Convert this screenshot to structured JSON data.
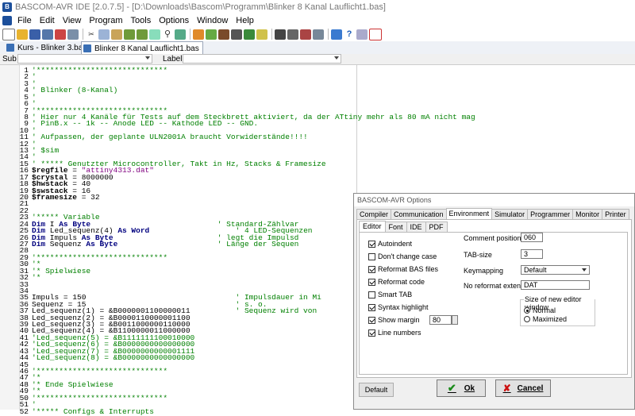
{
  "window": {
    "title": "BASCOM-AVR IDE [2.0.7.5] - [D:\\Downloads\\Bascom\\Programm\\Blinker 8 Kanal Lauflicht1.bas]"
  },
  "menu": [
    "File",
    "Edit",
    "View",
    "Program",
    "Tools",
    "Options",
    "Window",
    "Help"
  ],
  "tabs": [
    {
      "label": "Kurs - Blinker 3.bas",
      "active": false
    },
    {
      "label": "Blinker 8 Kanal Lauflicht1.bas",
      "active": true
    }
  ],
  "subbar": {
    "sub_label": "Sub",
    "label_label": "Label"
  },
  "code": [
    [
      [
        "cm",
        "'*****************************"
      ]
    ],
    [
      [
        "cm",
        "'"
      ]
    ],
    [
      [
        "cm",
        "'"
      ]
    ],
    [
      [
        "cm",
        "' Blinker (8-Kanal)"
      ]
    ],
    [
      [
        "cm",
        "'"
      ]
    ],
    [
      [
        "cm",
        "'"
      ]
    ],
    [
      [
        "cm",
        "'*****************************"
      ]
    ],
    [
      [
        "cm",
        "' Hier nur 4 Kanäle für Tests auf dem Steckbrett aktiviert, da der ATtiny mehr als 80 mA nicht mag"
      ]
    ],
    [
      [
        "cm",
        "' PinB.x -- 1k -- Anode LED -- Kathode LED -- GND."
      ]
    ],
    [
      [
        "cm",
        "'"
      ]
    ],
    [
      [
        "cm",
        "' Aufpassen, der geplante ULN2001A braucht Vorwiderstände!!!!"
      ]
    ],
    [
      [
        "cm",
        "'"
      ]
    ],
    [
      [
        "cm",
        "' $sim"
      ]
    ],
    [
      [
        "cm",
        "'"
      ]
    ],
    [
      [
        "cm",
        "' ***** Genutzter Microcontroller, Takt in Hz, Stacks & Framesize"
      ]
    ],
    [
      [
        "dir",
        "$regfile"
      ],
      [
        "num",
        " = "
      ],
      [
        "str",
        "\"attiny4313.dat\""
      ]
    ],
    [
      [
        "dir",
        "$crystal"
      ],
      [
        "num",
        " = 8000000"
      ]
    ],
    [
      [
        "dir",
        "$hwstack"
      ],
      [
        "num",
        " = 40"
      ]
    ],
    [
      [
        "dir",
        "$swstack"
      ],
      [
        "num",
        " = 16"
      ]
    ],
    [
      [
        "dir",
        "$framesize"
      ],
      [
        "num",
        " = 32"
      ]
    ],
    [],
    [],
    [
      [
        "cm",
        "'***** Variable"
      ]
    ],
    [
      [
        "kw",
        "Dim"
      ],
      [
        "num",
        " I "
      ],
      [
        "kw",
        "As Byte"
      ],
      [
        "num",
        "                            "
      ],
      [
        "cm",
        "' Standard-Zählvar"
      ]
    ],
    [
      [
        "kw",
        "Dim"
      ],
      [
        "num",
        " Led_sequenz(4) "
      ],
      [
        "kw",
        "As Word"
      ],
      [
        "num",
        "                   "
      ],
      [
        "cm",
        "' 4 LED-Sequenzen"
      ]
    ],
    [
      [
        "kw",
        "Dim"
      ],
      [
        "num",
        " Impuls "
      ],
      [
        "kw",
        "As Byte"
      ],
      [
        "num",
        "                       "
      ],
      [
        "cm",
        "' legt die Impulsd"
      ]
    ],
    [
      [
        "kw",
        "Dim"
      ],
      [
        "num",
        " Sequenz "
      ],
      [
        "kw",
        "As Byte"
      ],
      [
        "num",
        "                      "
      ],
      [
        "cm",
        "' Länge der Sequen"
      ]
    ],
    [],
    [
      [
        "cm",
        "'*****************************"
      ]
    ],
    [
      [
        "cm",
        "'*"
      ]
    ],
    [
      [
        "cm",
        "'* Spielwiese"
      ]
    ],
    [
      [
        "cm",
        "'*"
      ]
    ],
    [],
    [],
    [
      [
        "num",
        "Impuls = 150                                 "
      ],
      [
        "cm",
        "' Impulsdauer in Mi"
      ]
    ],
    [
      [
        "num",
        "Sequenz = 15                                 "
      ],
      [
        "cm",
        "' s. o."
      ]
    ],
    [
      [
        "num",
        "Led_sequenz(1) = &B0000001100000011          "
      ],
      [
        "cm",
        "' Sequenz wird von"
      ]
    ],
    [
      [
        "num",
        "Led_sequenz(2) = &B0000110000001100"
      ]
    ],
    [
      [
        "num",
        "Led_sequenz(3) = &B0011000000110000"
      ]
    ],
    [
      [
        "num",
        "Led_sequenz(4) = &B1100000011000000"
      ]
    ],
    [
      [
        "cm",
        "'Led_sequenz(5) = &B1111111100010000"
      ]
    ],
    [
      [
        "cm",
        "'Led_sequenz(6) = &B0000000000000000"
      ]
    ],
    [
      [
        "cm",
        "'Led_sequenz(7) = &B0000000000001111"
      ]
    ],
    [
      [
        "cm",
        "'Led_sequenz(8) = &B0000000000000000"
      ]
    ],
    [],
    [
      [
        "cm",
        "'*****************************"
      ]
    ],
    [
      [
        "cm",
        "'*"
      ]
    ],
    [
      [
        "cm",
        "'* Ende Spielwiese"
      ]
    ],
    [
      [
        "cm",
        "'*"
      ]
    ],
    [
      [
        "cm",
        "'*****************************"
      ]
    ],
    [
      [
        "cm",
        "'"
      ]
    ],
    [
      [
        "cm",
        "'***** Configs & Interrupts"
      ]
    ]
  ],
  "dialog": {
    "title": "BASCOM-AVR Options",
    "tabs": [
      "Compiler",
      "Communication",
      "Environment",
      "Simulator",
      "Programmer",
      "Monitor",
      "Printer"
    ],
    "active_tab": "Environment",
    "subtabs": [
      "Editor",
      "Font",
      "IDE",
      "PDF"
    ],
    "active_subtab": "Editor",
    "checkboxes": [
      {
        "label": "Autoindent",
        "checked": true
      },
      {
        "label": "Don't change case",
        "checked": false
      },
      {
        "label": "Reformat BAS files",
        "checked": true
      },
      {
        "label": "Reformat code",
        "checked": true
      },
      {
        "label": "Smart TAB",
        "checked": false
      },
      {
        "label": "Syntax highlight",
        "checked": true
      },
      {
        "label": "Show margin",
        "checked": true
      },
      {
        "label": "Line numbers",
        "checked": true
      }
    ],
    "show_margin_value": "80",
    "comment_position_label": "Comment position",
    "comment_position_value": "060",
    "tab_size_label": "TAB-size",
    "tab_size_value": "3",
    "keymapping_label": "Keymapping",
    "keymapping_value": "Default",
    "no_reformat_label": "No reformat extension",
    "no_reformat_value": "DAT",
    "new_window_group_label": "Size of new editor window",
    "radio_normal": "Normal",
    "radio_maximized": "Maximized",
    "radio_selected": "Normal",
    "default_button": "Default",
    "ok_button": "Ok",
    "cancel_button": "Cancel"
  },
  "colors": {
    "comment": "#008000",
    "keyword": "#00007f",
    "string": "#7f007f"
  }
}
